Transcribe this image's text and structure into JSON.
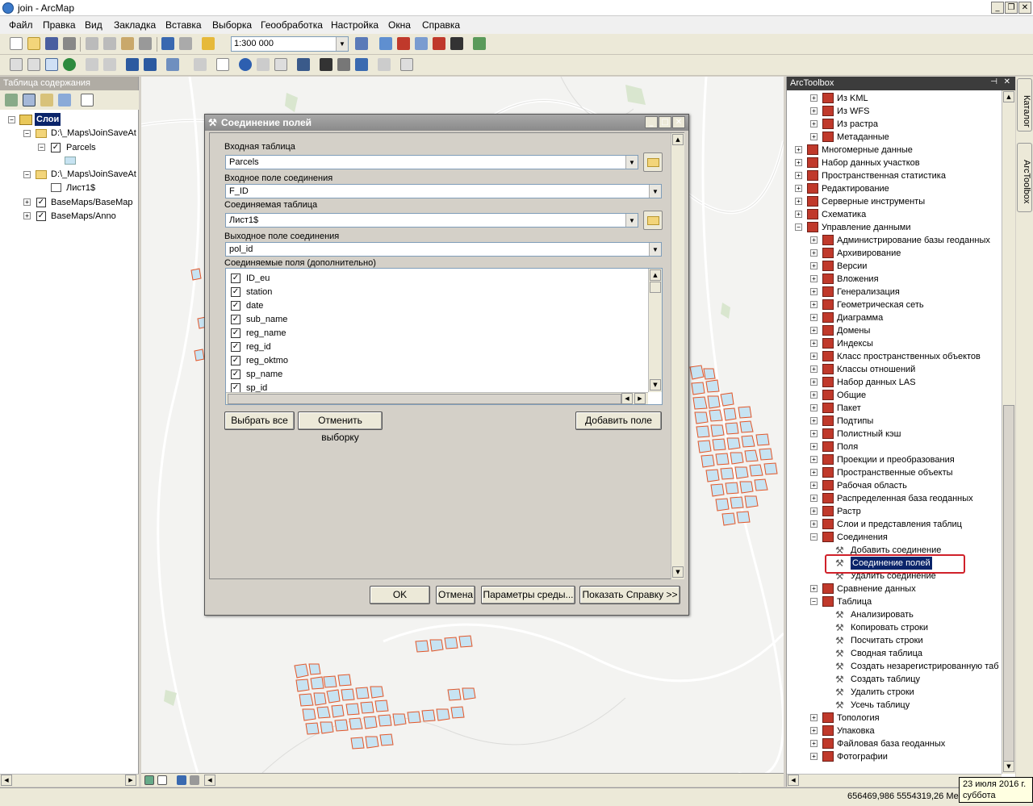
{
  "window": {
    "title": "join - ArcMap"
  },
  "menu": [
    "Файл",
    "Правка",
    "Вид",
    "Закладка",
    "Вставка",
    "Выборка",
    "Геообработка",
    "Настройка",
    "Окна",
    "Справка"
  ],
  "toolbar": {
    "scale": "1:300 000"
  },
  "toc": {
    "title": "Таблица содержания",
    "root": "Слои",
    "items": [
      "D:\\_Maps\\JoinSaveAt",
      "Parcels",
      "D:\\_Maps\\JoinSaveAt",
      "Лист1$",
      "BaseMaps/BaseMap",
      "BaseMaps/Anno"
    ]
  },
  "dialog": {
    "title": "Соединение полей",
    "input_table_label": "Входная таблица",
    "input_table": "Parcels",
    "input_join_field_label": "Входное поле соединения",
    "input_join_field": "F_ID",
    "join_table_label": "Соединяемая таблица",
    "join_table": "Лист1$",
    "output_join_field_label": "Выходное поле соединения",
    "output_join_field": "pol_id",
    "join_fields_label": "Соединяемые поля (дополнительно)",
    "fields": [
      "ID_eu",
      "station",
      "date",
      "sub_name",
      "reg_name",
      "reg_id",
      "reg_oktmo",
      "sp_name",
      "sp_id"
    ],
    "select_all": "Выбрать все",
    "unselect_all": "Отменить выборку",
    "add_field": "Добавить поле",
    "ok": "OK",
    "cancel": "Отмена",
    "env": "Параметры среды...",
    "show_help": "Показать Справку >>"
  },
  "toolbox": {
    "title": "ArcToolbox",
    "items": [
      {
        "label": "Из KML",
        "level": 1,
        "type": "box"
      },
      {
        "label": "Из WFS",
        "level": 1,
        "type": "box"
      },
      {
        "label": "Из растра",
        "level": 1,
        "type": "box"
      },
      {
        "label": "Метаданные",
        "level": 1,
        "type": "box"
      },
      {
        "label": "Многомерные данные",
        "level": 0,
        "type": "box"
      },
      {
        "label": "Набор данных участков",
        "level": 0,
        "type": "box"
      },
      {
        "label": "Пространственная статистика",
        "level": 0,
        "type": "box"
      },
      {
        "label": "Редактирование",
        "level": 0,
        "type": "box"
      },
      {
        "label": "Серверные инструменты",
        "level": 0,
        "type": "box"
      },
      {
        "label": "Схематика",
        "level": 0,
        "type": "box"
      },
      {
        "label": "Управление данными",
        "level": 0,
        "type": "box",
        "open": true
      },
      {
        "label": "Администрирование базы геоданных",
        "level": 1,
        "type": "box"
      },
      {
        "label": "Архивирование",
        "level": 1,
        "type": "box"
      },
      {
        "label": "Версии",
        "level": 1,
        "type": "box"
      },
      {
        "label": "Вложения",
        "level": 1,
        "type": "box"
      },
      {
        "label": "Генерализация",
        "level": 1,
        "type": "box"
      },
      {
        "label": "Геометрическая сеть",
        "level": 1,
        "type": "box"
      },
      {
        "label": "Диаграмма",
        "level": 1,
        "type": "box"
      },
      {
        "label": "Домены",
        "level": 1,
        "type": "box"
      },
      {
        "label": "Индексы",
        "level": 1,
        "type": "box"
      },
      {
        "label": "Класс пространственных объектов",
        "level": 1,
        "type": "box"
      },
      {
        "label": "Классы отношений",
        "level": 1,
        "type": "box"
      },
      {
        "label": "Набор данных LAS",
        "level": 1,
        "type": "box"
      },
      {
        "label": "Общие",
        "level": 1,
        "type": "box"
      },
      {
        "label": "Пакет",
        "level": 1,
        "type": "box"
      },
      {
        "label": "Подтипы",
        "level": 1,
        "type": "box"
      },
      {
        "label": "Полистный кэш",
        "level": 1,
        "type": "box"
      },
      {
        "label": "Поля",
        "level": 1,
        "type": "box"
      },
      {
        "label": "Проекции и преобразования",
        "level": 1,
        "type": "box"
      },
      {
        "label": "Пространственные объекты",
        "level": 1,
        "type": "box"
      },
      {
        "label": "Рабочая область",
        "level": 1,
        "type": "box"
      },
      {
        "label": "Распределенная база геоданных",
        "level": 1,
        "type": "box"
      },
      {
        "label": "Растр",
        "level": 1,
        "type": "box"
      },
      {
        "label": "Слои и представления таблиц",
        "level": 1,
        "type": "box"
      },
      {
        "label": "Соединения",
        "level": 1,
        "type": "box",
        "open": true
      },
      {
        "label": "Добавить соединение",
        "level": 2,
        "type": "tool"
      },
      {
        "label": "Соединение полей",
        "level": 2,
        "type": "tool",
        "selected": true
      },
      {
        "label": "Удалить соединение",
        "level": 2,
        "type": "tool"
      },
      {
        "label": "Сравнение данных",
        "level": 1,
        "type": "box"
      },
      {
        "label": "Таблица",
        "level": 1,
        "type": "box",
        "open": true
      },
      {
        "label": "Анализировать",
        "level": 2,
        "type": "tool"
      },
      {
        "label": "Копировать строки",
        "level": 2,
        "type": "tool"
      },
      {
        "label": "Посчитать строки",
        "level": 2,
        "type": "tool"
      },
      {
        "label": "Сводная таблица",
        "level": 2,
        "type": "tool"
      },
      {
        "label": "Создать незарегистрированную таб",
        "level": 2,
        "type": "tool"
      },
      {
        "label": "Создать таблицу",
        "level": 2,
        "type": "tool"
      },
      {
        "label": "Удалить строки",
        "level": 2,
        "type": "tool"
      },
      {
        "label": "Усечь таблицу",
        "level": 2,
        "type": "tool"
      },
      {
        "label": "Топология",
        "level": 1,
        "type": "box"
      },
      {
        "label": "Упаковка",
        "level": 1,
        "type": "box"
      },
      {
        "label": "Файловая база геоданных",
        "level": 1,
        "type": "box"
      },
      {
        "label": "Фотографии",
        "level": 1,
        "type": "box"
      }
    ]
  },
  "side_tabs": [
    "Каталог",
    "ArcToolbox"
  ],
  "status": {
    "coords": "656469,986  5554319,26 Ме"
  },
  "tooltip": {
    "line1": "23 июля 2016 г.",
    "line2": "суббота"
  },
  "colors": {
    "parcel_fill": "#c7e3f2",
    "parcel_stroke": "#e2572a",
    "selection": "#0a246a",
    "highlight": "#d0212a"
  }
}
